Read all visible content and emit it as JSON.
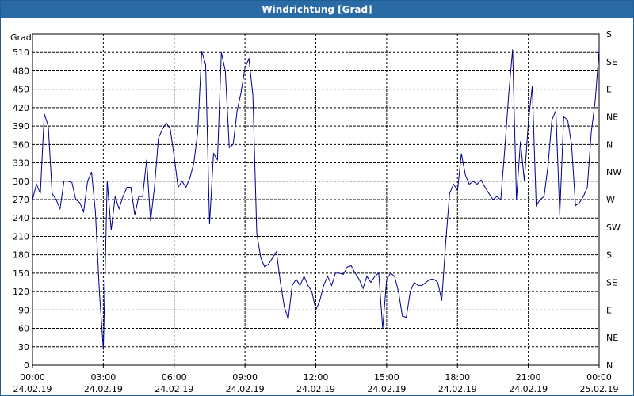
{
  "window": {
    "title": "Windrichtung [Grad]"
  },
  "chart_data": {
    "type": "line",
    "title": "Windrichtung [Grad]",
    "ylabel": "Grad",
    "ylim": [
      0,
      540
    ],
    "yticks": [
      0,
      30,
      60,
      90,
      120,
      150,
      180,
      210,
      240,
      270,
      300,
      330,
      360,
      390,
      420,
      450,
      480,
      510
    ],
    "xlim": [
      "2019-02-24 00:00",
      "2019-02-25 00:00"
    ],
    "xticks": [
      {
        "time": "00:00",
        "date": "24.02.19"
      },
      {
        "time": "03:00",
        "date": "24.02.19"
      },
      {
        "time": "06:00",
        "date": "24.02.19"
      },
      {
        "time": "09:00",
        "date": "24.02.19"
      },
      {
        "time": "12:00",
        "date": "24.02.19"
      },
      {
        "time": "15:00",
        "date": "24.02.19"
      },
      {
        "time": "18:00",
        "date": "24.02.19"
      },
      {
        "time": "21:00",
        "date": "24.02.19"
      },
      {
        "time": "00:00",
        "date": "25.02.19"
      }
    ],
    "right_axis_labels": [
      "N",
      "NE",
      "E",
      "SE",
      "S",
      "SW",
      "W",
      "NW",
      "N",
      "NE",
      "E",
      "SE",
      "S"
    ],
    "grid": true,
    "colors": {
      "line": "#00008b",
      "grid": "#000000",
      "title_bar": "#2a6aa5"
    },
    "series": [
      {
        "x": [
          "00:00",
          "00:10",
          "00:20",
          "00:30",
          "00:40",
          "00:50",
          "01:00",
          "01:10",
          "01:20",
          "01:30",
          "01:40",
          "01:50",
          "02:00",
          "02:10",
          "02:20",
          "02:30",
          "02:40",
          "02:50",
          "03:00",
          "03:10",
          "03:20",
          "03:30",
          "03:40",
          "03:50",
          "04:00",
          "04:10",
          "04:20",
          "04:30",
          "04:40",
          "04:50",
          "05:00",
          "05:10",
          "05:20",
          "05:30",
          "05:40",
          "05:50",
          "06:00",
          "06:10",
          "06:20",
          "06:30",
          "06:40",
          "06:50",
          "07:00",
          "07:10",
          "07:20",
          "07:30",
          "07:40",
          "07:50",
          "08:00",
          "08:10",
          "08:20",
          "08:30",
          "08:40",
          "08:50",
          "09:00",
          "09:10",
          "09:20",
          "09:30",
          "09:40",
          "09:50",
          "10:00",
          "10:10",
          "10:20",
          "10:30",
          "10:40",
          "10:50",
          "11:00",
          "11:10",
          "11:20",
          "11:30",
          "11:40",
          "11:50",
          "12:00",
          "12:10",
          "12:20",
          "12:30",
          "12:40",
          "12:50",
          "13:00",
          "13:10",
          "13:20",
          "13:30",
          "13:40",
          "13:50",
          "14:00",
          "14:10",
          "14:20",
          "14:30",
          "14:40",
          "14:50",
          "15:00",
          "15:10",
          "15:20",
          "15:30",
          "15:40",
          "15:50",
          "16:00",
          "16:10",
          "16:20",
          "16:30",
          "16:40",
          "16:50",
          "17:00",
          "17:10",
          "17:20",
          "17:30",
          "17:40",
          "17:50",
          "18:00",
          "18:10",
          "18:20",
          "18:30",
          "18:40",
          "18:50",
          "19:00",
          "19:10",
          "19:20",
          "19:30",
          "19:40",
          "19:50",
          "20:00",
          "20:10",
          "20:20",
          "20:30",
          "20:40",
          "20:50",
          "21:00",
          "21:10",
          "21:20",
          "21:30",
          "21:40",
          "21:50",
          "22:00",
          "22:10",
          "22:20",
          "22:30",
          "22:40",
          "22:50",
          "23:00",
          "23:10",
          "23:20",
          "23:30",
          "23:40",
          "23:50",
          "24:00"
        ],
        "values": [
          270,
          295,
          280,
          410,
          390,
          280,
          270,
          255,
          300,
          300,
          298,
          270,
          265,
          250,
          300,
          315,
          250,
          120,
          25,
          300,
          220,
          275,
          255,
          275,
          290,
          290,
          245,
          275,
          275,
          335,
          235,
          290,
          370,
          385,
          395,
          385,
          340,
          290,
          300,
          290,
          305,
          330,
          380,
          512,
          490,
          230,
          345,
          335,
          510,
          480,
          355,
          360,
          415,
          445,
          485,
          500,
          440,
          215,
          175,
          160,
          165,
          175,
          185,
          135,
          95,
          75,
          130,
          140,
          130,
          145,
          130,
          120,
          90,
          105,
          130,
          145,
          130,
          150,
          150,
          148,
          160,
          162,
          150,
          140,
          125,
          145,
          135,
          145,
          150,
          60,
          140,
          150,
          145,
          120,
          80,
          78,
          120,
          135,
          130,
          130,
          135,
          140,
          140,
          135,
          105,
          200,
          280,
          295,
          285,
          345,
          310,
          295,
          300,
          295,
          302,
          290,
          280,
          270,
          275,
          270,
          350,
          440,
          515,
          270,
          365,
          300,
          395,
          455,
          260,
          270,
          275,
          325,
          400,
          415,
          245,
          405,
          400,
          360,
          260,
          265,
          275,
          290,
          380,
          430,
          515
        ]
      }
    ]
  }
}
